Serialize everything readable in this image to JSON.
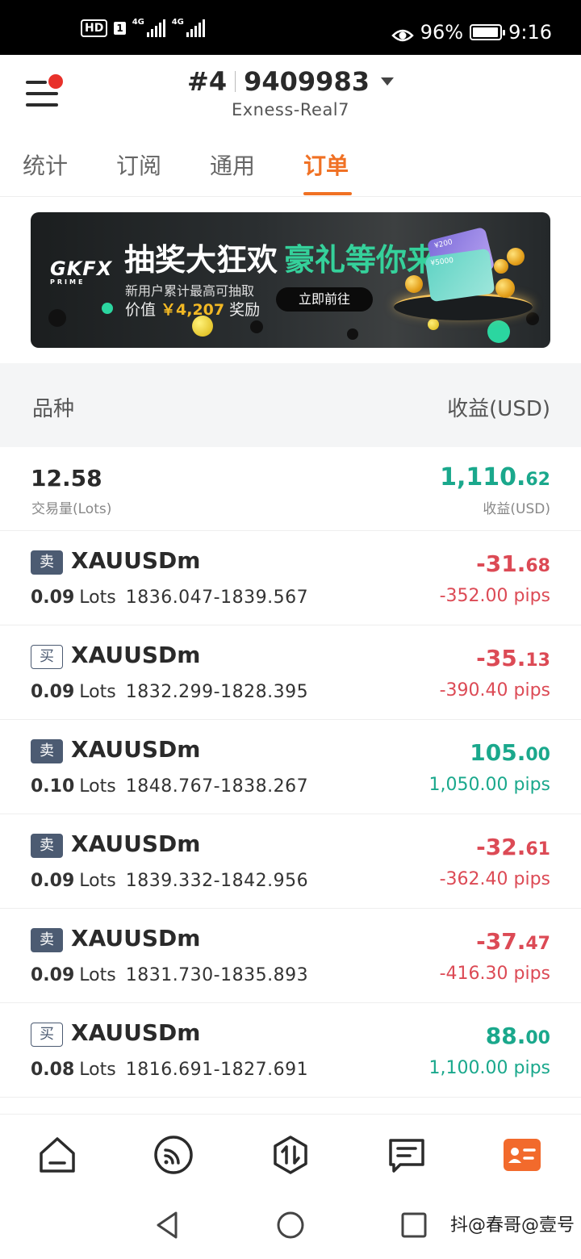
{
  "status_bar": {
    "hd_label": "HD",
    "sim_label": "1",
    "signal_tag_1": "4G",
    "signal_tag_2": "4G",
    "battery": "96%",
    "time": "9:16",
    "battery_level": 0.96
  },
  "header": {
    "account_prefix": "#4",
    "account_number": "9409983",
    "server": "Exness-Real7",
    "menu_has_notification": true
  },
  "tabs": [
    {
      "label": "统计",
      "active": false
    },
    {
      "label": "订阅",
      "active": false
    },
    {
      "label": "通用",
      "active": false
    },
    {
      "label": "订单",
      "active": true
    }
  ],
  "banner": {
    "logo": "GKFX",
    "logo_sub": "PRIME",
    "title_white": "抽奖大狂欢",
    "title_green": "豪礼等你来",
    "subtitle": "新用户累计最高可抽取",
    "value_prefix": "价值",
    "value_amount": "￥4,207",
    "value_suffix": "奖励",
    "cta": "立即前往",
    "card_label_1": "¥200",
    "card_label_2": "¥5000"
  },
  "list_header": {
    "left": "品种",
    "right": "收益(USD)"
  },
  "summary": {
    "volume": "12.58",
    "volume_label": "交易量(Lots)",
    "profit_int": "1,110.",
    "profit_dec": "62",
    "profit_label": "收益(USD)"
  },
  "orders": [
    {
      "side": "卖",
      "side_type": "sell",
      "symbol": "XAUUSDm",
      "lots": "0.09",
      "lots_unit": "Lots",
      "prices": "1836.047-1839.567",
      "pnl_int": "-31.",
      "pnl_dec": "68",
      "pips": "-352.00 pips",
      "positive": false
    },
    {
      "side": "买",
      "side_type": "buy",
      "symbol": "XAUUSDm",
      "lots": "0.09",
      "lots_unit": "Lots",
      "prices": "1832.299-1828.395",
      "pnl_int": "-35.",
      "pnl_dec": "13",
      "pips": "-390.40 pips",
      "positive": false
    },
    {
      "side": "卖",
      "side_type": "sell",
      "symbol": "XAUUSDm",
      "lots": "0.10",
      "lots_unit": "Lots",
      "prices": "1848.767-1838.267",
      "pnl_int": "105.",
      "pnl_dec": "00",
      "pips": "1,050.00 pips",
      "positive": true
    },
    {
      "side": "卖",
      "side_type": "sell",
      "symbol": "XAUUSDm",
      "lots": "0.09",
      "lots_unit": "Lots",
      "prices": "1839.332-1842.956",
      "pnl_int": "-32.",
      "pnl_dec": "61",
      "pips": "-362.40 pips",
      "positive": false
    },
    {
      "side": "卖",
      "side_type": "sell",
      "symbol": "XAUUSDm",
      "lots": "0.09",
      "lots_unit": "Lots",
      "prices": "1831.730-1835.893",
      "pnl_int": "-37.",
      "pnl_dec": "47",
      "pips": "-416.30 pips",
      "positive": false
    },
    {
      "side": "买",
      "side_type": "buy",
      "symbol": "XAUUSDm",
      "lots": "0.08",
      "lots_unit": "Lots",
      "prices": "1816.691-1827.691",
      "pnl_int": "88.",
      "pnl_dec": "00",
      "pips": "1,100.00 pips",
      "positive": true
    }
  ],
  "bottom_nav": [
    {
      "icon": "home-icon",
      "active": false
    },
    {
      "icon": "signal-feed-icon",
      "active": false
    },
    {
      "icon": "trade-icon",
      "active": false
    },
    {
      "icon": "messages-icon",
      "active": false
    },
    {
      "icon": "profile-card-icon",
      "active": true
    }
  ],
  "system_nav": {
    "watermark": "抖@春哥@壹号"
  },
  "colors": {
    "accent": "#f07124",
    "positive": "#1aa88c",
    "negative": "#dc4a55",
    "sell_badge": "#4c5b72",
    "banner_green": "#35d19b",
    "banner_gold": "#f2b824"
  }
}
